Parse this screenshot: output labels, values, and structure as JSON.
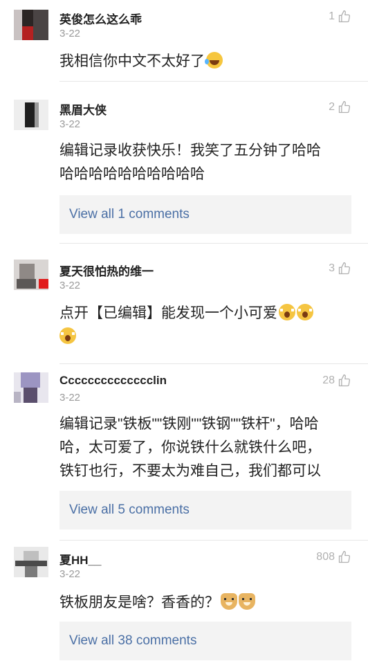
{
  "comments": [
    {
      "author": "英俊怎么这么乖",
      "date": "3-22",
      "likes": "1",
      "text": "我相信你中文不太好了",
      "emojis": [
        "crying-laughing"
      ]
    },
    {
      "author": "黑眉大侠",
      "date": "3-22",
      "likes": "2",
      "text_line1": "编辑记录收获快乐！我笑了五分钟了哈哈",
      "text_line2": "哈哈哈哈哈哈哈哈哈哈",
      "replies_label": "View all 1 comments"
    },
    {
      "author": "夏天很怕热的维一",
      "date": "3-22",
      "likes": "3",
      "text": "点开【已编辑】能发现一个小可爱",
      "emojis": [
        "scared-face",
        "scared-face",
        "scared-face"
      ]
    },
    {
      "author": "Cccccccccccccclin",
      "date": "3-22",
      "likes": "28",
      "text_line1": "编辑记录\"铁板\"\"铁刚\"\"铁钢\"\"铁杆\"，哈哈",
      "text_line2": "哈，太可爱了，你说铁什么就铁什么吧，",
      "text_line3": "铁钉也行，不要太为难自己，我们都可以",
      "replies_label": "View all 5 comments"
    },
    {
      "author": "夏HH__",
      "date": "3-22",
      "likes": "808",
      "text": "铁板朋友是啥？香香的？",
      "emojis": [
        "doge",
        "doge"
      ],
      "replies_label": "View all 38 comments"
    }
  ],
  "colors": {
    "link": "#4a6fa5",
    "muted": "#9a9a9a",
    "reply_bg": "#f3f3f3"
  }
}
